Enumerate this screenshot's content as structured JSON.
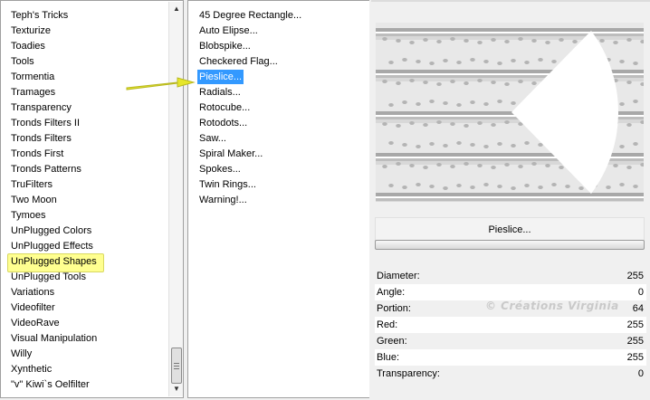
{
  "categories": {
    "items": [
      "Teph's Tricks",
      "Texturize",
      "Toadies",
      "Tools",
      "Tormentia",
      "Tramages",
      "Transparency",
      "Tronds Filters II",
      "Tronds Filters",
      "Tronds First",
      "Tronds Patterns",
      "TruFilters",
      "Two Moon",
      "Tymoes",
      "UnPlugged Colors",
      "UnPlugged Effects",
      "UnPlugged Shapes",
      "UnPlugged Tools",
      "Variations",
      "Videofilter",
      "VideoRave",
      "Visual Manipulation",
      "Willy",
      "Xynthetic",
      "\"v\" Kiwi`s Oelfilter"
    ],
    "selected": "UnPlugged Shapes"
  },
  "filters": {
    "items": [
      "45 Degree Rectangle...",
      "Auto Elipse...",
      "Blobspike...",
      "Checkered Flag...",
      "Pieslice...",
      "Radials...",
      "Rotocube...",
      "Rotodots...",
      "Saw...",
      "Spiral Maker...",
      "Spokes...",
      "Twin Rings...",
      "Warning!..."
    ],
    "selected": "Pieslice..."
  },
  "filter_name": "Pieslice...",
  "parameters": [
    {
      "label": "Diameter:",
      "value": "255"
    },
    {
      "label": "Angle:",
      "value": "0"
    },
    {
      "label": "Portion:",
      "value": "64"
    },
    {
      "label": "Red:",
      "value": "255"
    },
    {
      "label": "Green:",
      "value": "255"
    },
    {
      "label": "Blue:",
      "value": "255"
    },
    {
      "label": "Transparency:",
      "value": "0"
    }
  ],
  "watermark": "© Créations Virginia",
  "colors": {
    "selection": "#3399ff",
    "highlight": "#ffff90",
    "arrow": "#e6e62a"
  },
  "icons": {
    "scroll_up": "triangle-up-icon",
    "scroll_down": "triangle-down-icon",
    "pointer": "arrow-right-icon"
  }
}
